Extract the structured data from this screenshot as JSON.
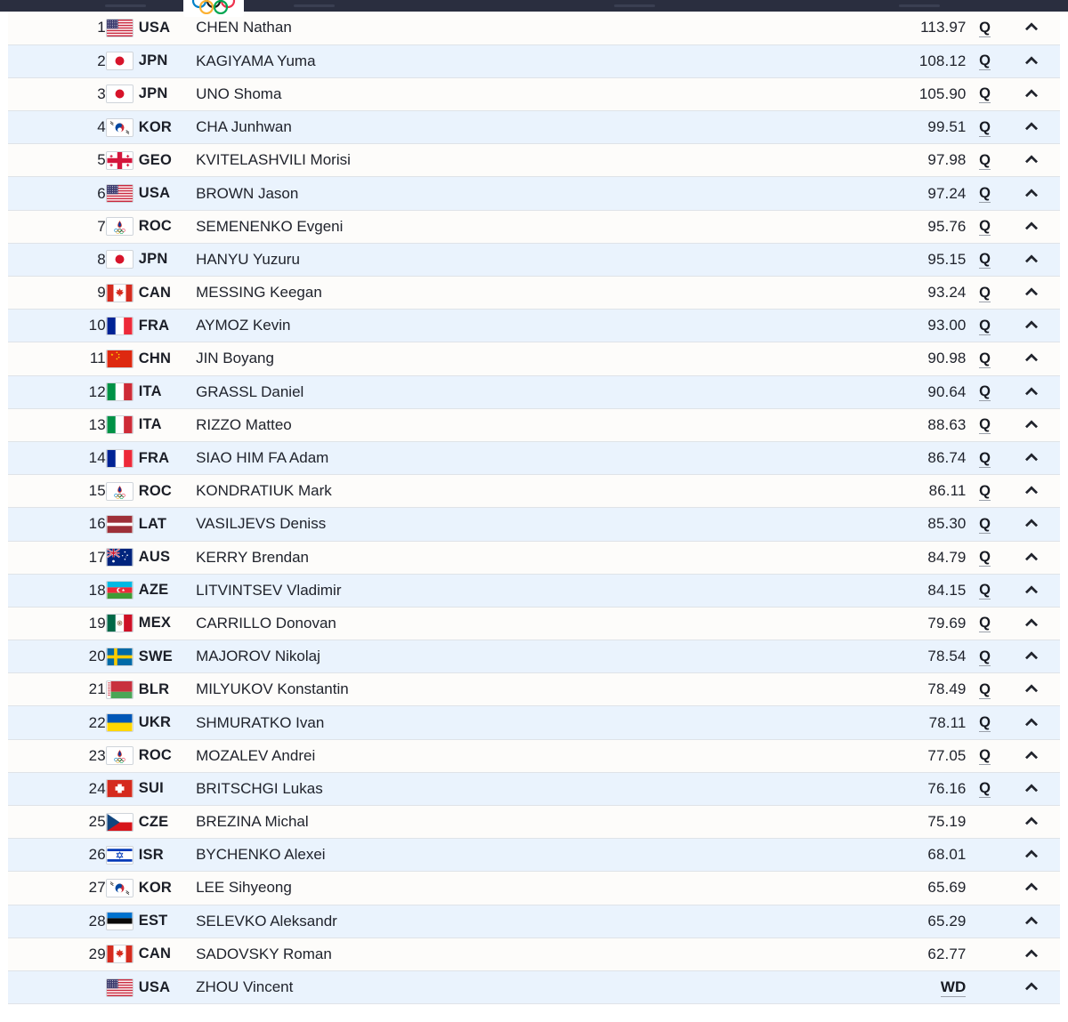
{
  "header": {
    "olympic_rings_icon": "olympic-rings-icon",
    "bar_color": "#2a2e3f"
  },
  "table": {
    "qualified_marker": "Q",
    "withdrawn_marker": "WD",
    "expand_icon": "chevron-up-icon",
    "row_colors": {
      "even": "#eaf3fd",
      "odd": "#fdfcfa",
      "border": "#dfe3e8"
    },
    "rows": [
      {
        "rank": "1",
        "noc": "USA",
        "flag": "usa",
        "name": "CHEN Nathan",
        "score": "113.97",
        "q": "Q"
      },
      {
        "rank": "2",
        "noc": "JPN",
        "flag": "jpn",
        "name": "KAGIYAMA Yuma",
        "score": "108.12",
        "q": "Q"
      },
      {
        "rank": "3",
        "noc": "JPN",
        "flag": "jpn",
        "name": "UNO Shoma",
        "score": "105.90",
        "q": "Q"
      },
      {
        "rank": "4",
        "noc": "KOR",
        "flag": "kor",
        "name": "CHA Junhwan",
        "score": "99.51",
        "q": "Q"
      },
      {
        "rank": "5",
        "noc": "GEO",
        "flag": "geo",
        "name": "KVITELASHVILI Morisi",
        "score": "97.98",
        "q": "Q"
      },
      {
        "rank": "6",
        "noc": "USA",
        "flag": "usa",
        "name": "BROWN Jason",
        "score": "97.24",
        "q": "Q"
      },
      {
        "rank": "7",
        "noc": "ROC",
        "flag": "roc",
        "name": "SEMENENKO Evgeni",
        "score": "95.76",
        "q": "Q"
      },
      {
        "rank": "8",
        "noc": "JPN",
        "flag": "jpn",
        "name": "HANYU Yuzuru",
        "score": "95.15",
        "q": "Q"
      },
      {
        "rank": "9",
        "noc": "CAN",
        "flag": "can",
        "name": "MESSING Keegan",
        "score": "93.24",
        "q": "Q"
      },
      {
        "rank": "10",
        "noc": "FRA",
        "flag": "fra",
        "name": "AYMOZ Kevin",
        "score": "93.00",
        "q": "Q"
      },
      {
        "rank": "11",
        "noc": "CHN",
        "flag": "chn",
        "name": "JIN Boyang",
        "score": "90.98",
        "q": "Q"
      },
      {
        "rank": "12",
        "noc": "ITA",
        "flag": "ita",
        "name": "GRASSL Daniel",
        "score": "90.64",
        "q": "Q"
      },
      {
        "rank": "13",
        "noc": "ITA",
        "flag": "ita",
        "name": "RIZZO Matteo",
        "score": "88.63",
        "q": "Q"
      },
      {
        "rank": "14",
        "noc": "FRA",
        "flag": "fra",
        "name": "SIAO HIM FA Adam",
        "score": "86.74",
        "q": "Q"
      },
      {
        "rank": "15",
        "noc": "ROC",
        "flag": "roc",
        "name": "KONDRATIUK Mark",
        "score": "86.11",
        "q": "Q"
      },
      {
        "rank": "16",
        "noc": "LAT",
        "flag": "lat",
        "name": "VASILJEVS Deniss",
        "score": "85.30",
        "q": "Q"
      },
      {
        "rank": "17",
        "noc": "AUS",
        "flag": "aus",
        "name": "KERRY Brendan",
        "score": "84.79",
        "q": "Q"
      },
      {
        "rank": "18",
        "noc": "AZE",
        "flag": "aze",
        "name": "LITVINTSEV Vladimir",
        "score": "84.15",
        "q": "Q"
      },
      {
        "rank": "19",
        "noc": "MEX",
        "flag": "mex",
        "name": "CARRILLO Donovan",
        "score": "79.69",
        "q": "Q"
      },
      {
        "rank": "20",
        "noc": "SWE",
        "flag": "swe",
        "name": "MAJOROV Nikolaj",
        "score": "78.54",
        "q": "Q"
      },
      {
        "rank": "21",
        "noc": "BLR",
        "flag": "blr",
        "name": "MILYUKOV Konstantin",
        "score": "78.49",
        "q": "Q"
      },
      {
        "rank": "22",
        "noc": "UKR",
        "flag": "ukr",
        "name": "SHMURATKO Ivan",
        "score": "78.11",
        "q": "Q"
      },
      {
        "rank": "23",
        "noc": "ROC",
        "flag": "roc",
        "name": "MOZALEV Andrei",
        "score": "77.05",
        "q": "Q"
      },
      {
        "rank": "24",
        "noc": "SUI",
        "flag": "sui",
        "name": "BRITSCHGI Lukas",
        "score": "76.16",
        "q": "Q"
      },
      {
        "rank": "25",
        "noc": "CZE",
        "flag": "cze",
        "name": "BREZINA Michal",
        "score": "75.19",
        "q": ""
      },
      {
        "rank": "26",
        "noc": "ISR",
        "flag": "isr",
        "name": "BYCHENKO Alexei",
        "score": "68.01",
        "q": ""
      },
      {
        "rank": "27",
        "noc": "KOR",
        "flag": "kor",
        "name": "LEE Sihyeong",
        "score": "65.69",
        "q": ""
      },
      {
        "rank": "28",
        "noc": "EST",
        "flag": "est",
        "name": "SELEVKO Aleksandr",
        "score": "65.29",
        "q": ""
      },
      {
        "rank": "29",
        "noc": "CAN",
        "flag": "can",
        "name": "SADOVSKY Roman",
        "score": "62.77",
        "q": ""
      },
      {
        "rank": "",
        "noc": "USA",
        "flag": "usa",
        "name": "ZHOU Vincent",
        "score": "WD",
        "q": "",
        "withdrawn": true
      }
    ]
  }
}
